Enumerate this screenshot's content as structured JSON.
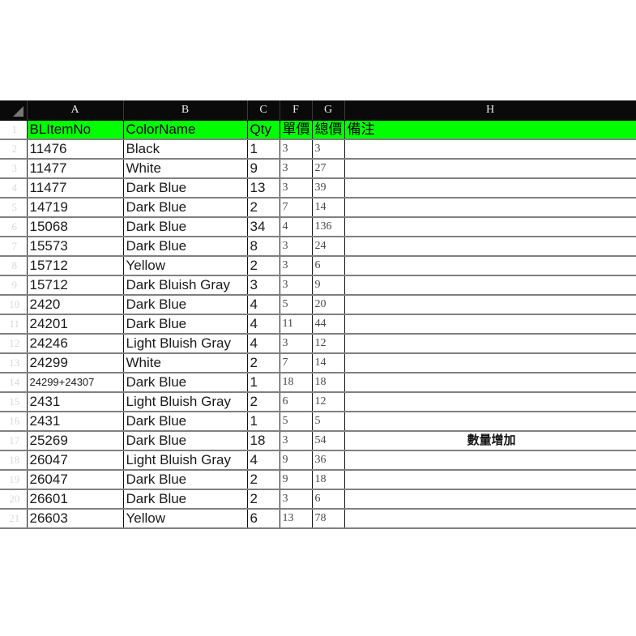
{
  "app": {
    "type": "spreadsheet",
    "corner_icon": "select-all-triangle-icon"
  },
  "columns": {
    "letters": [
      "A",
      "B",
      "C",
      "F",
      "G",
      "H"
    ],
    "widths": [
      119,
      153,
      40,
      40,
      40,
      360
    ]
  },
  "sheet_header": {
    "row_number": "1",
    "fill_color": "#00ff00",
    "cells": {
      "a": "BLItemNo",
      "b": "ColorName",
      "c": "Qty",
      "f": "單價",
      "g": "總價",
      "h": "備注"
    }
  },
  "rows": [
    {
      "n": "2",
      "a": "11476",
      "b": "Black",
      "c": "1",
      "f": "3",
      "g": "3",
      "h": ""
    },
    {
      "n": "3",
      "a": "11477",
      "b": "White",
      "c": "9",
      "f": "3",
      "g": "27",
      "h": ""
    },
    {
      "n": "4",
      "a": "11477",
      "b": "Dark Blue",
      "c": "13",
      "f": "3",
      "g": "39",
      "h": ""
    },
    {
      "n": "5",
      "a": "14719",
      "b": "Dark Blue",
      "c": "2",
      "f": "7",
      "g": "14",
      "h": ""
    },
    {
      "n": "6",
      "a": "15068",
      "b": "Dark Blue",
      "c": "34",
      "f": "4",
      "g": "136",
      "h": ""
    },
    {
      "n": "7",
      "a": "15573",
      "b": "Dark Blue",
      "c": "8",
      "f": "3",
      "g": "24",
      "h": ""
    },
    {
      "n": "8",
      "a": "15712",
      "b": "Yellow",
      "c": "2",
      "f": "3",
      "g": "6",
      "h": ""
    },
    {
      "n": "9",
      "a": "15712",
      "b": "Dark Bluish Gray",
      "c": "3",
      "f": "3",
      "g": "9",
      "h": ""
    },
    {
      "n": "10",
      "a": "2420",
      "b": "Dark Blue",
      "c": "4",
      "f": "5",
      "g": "20",
      "h": ""
    },
    {
      "n": "11",
      "a": "24201",
      "b": "Dark Blue",
      "c": "4",
      "f": "11",
      "g": "44",
      "h": ""
    },
    {
      "n": "12",
      "a": "24246",
      "b": "Light Bluish Gray",
      "c": "4",
      "f": "3",
      "g": "12",
      "h": ""
    },
    {
      "n": "13",
      "a": "24299",
      "b": "White",
      "c": "2",
      "f": "7",
      "g": "14",
      "h": ""
    },
    {
      "n": "14",
      "a": "24299+24307",
      "b": "Dark Blue",
      "c": "1",
      "f": "18",
      "g": "18",
      "h": "",
      "a_small": true
    },
    {
      "n": "15",
      "a": "2431",
      "b": "Light Bluish Gray",
      "c": "2",
      "f": "6",
      "g": "12",
      "h": ""
    },
    {
      "n": "16",
      "a": "2431",
      "b": "Dark Blue",
      "c": "1",
      "f": "5",
      "g": "5",
      "h": ""
    },
    {
      "n": "17",
      "a": "25269",
      "b": "Dark Blue",
      "c": "18",
      "f": "3",
      "g": "54",
      "h": "數量增加"
    },
    {
      "n": "18",
      "a": "26047",
      "b": "Light Bluish Gray",
      "c": "4",
      "f": "9",
      "g": "36",
      "h": ""
    },
    {
      "n": "19",
      "a": "26047",
      "b": "Dark Blue",
      "c": "2",
      "f": "9",
      "g": "18",
      "h": ""
    },
    {
      "n": "20",
      "a": "26601",
      "b": "Dark Blue",
      "c": "2",
      "f": "3",
      "g": "6",
      "h": ""
    },
    {
      "n": "21",
      "a": "26603",
      "b": "Yellow",
      "c": "6",
      "f": "13",
      "g": "78",
      "h": ""
    }
  ],
  "colors": {
    "header_fill": "#00ff00",
    "gutter_background": "#0a0a0a",
    "gridline": "#808080",
    "page_background": "#ffffff"
  }
}
